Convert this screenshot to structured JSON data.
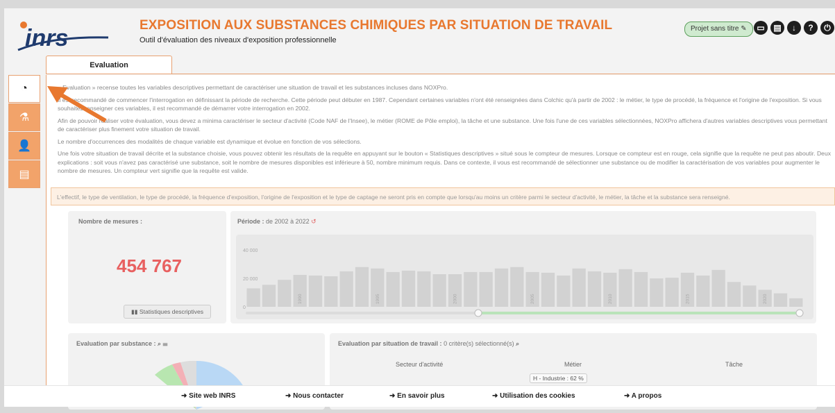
{
  "header": {
    "title": "EXPOSITION AUX SUBSTANCES CHIMIQUES PAR SITUATION DE TRAVAIL",
    "subtitle": "Outil d'évaluation des niveaux d'exposition professionnelle",
    "logo_text": "inrs",
    "project_button": "Projet sans titre"
  },
  "tabs": [
    {
      "label": "Evaluation"
    }
  ],
  "sidebar": [
    {
      "icon": "pie-chart-icon"
    },
    {
      "icon": "flask-icon"
    },
    {
      "icon": "user-settings-icon"
    },
    {
      "icon": "document-icon"
    }
  ],
  "intro": {
    "p1": "« Evaluation » recense toutes les variables descriptives permettant de caractériser une situation de travail et les substances incluses dans NOXPro.",
    "p2": "Il est recommandé de commencer l'interrogation en définissant la période de recherche. Cette période peut débuter en 1987. Cependant certaines variables n'ont été renseignées dans Colchic qu'à partir de 2002 : le métier, le type de procédé, la fréquence et l'origine de l'exposition. Si vous souhaitez renseigner ces variables, il est recommandé de démarrer votre interrogation en 2002.",
    "p3": "Afin de pouvoir réaliser votre évaluation, vous devez a minima caractériser le secteur d'activité (Code NAF de l'Insee), le métier (ROME de Pôle emploi), la tâche et une substance. Une fois l'une de ces variables sélectionnées, NOXPro affichera d'autres variables descriptives vous permettant de caractériser plus finement votre situation de travail.",
    "p4": "Le nombre d'occurrences des modalités de chaque variable est dynamique et évolue en fonction de vos sélections.",
    "p5": "Une fois votre situation de travail décrite et la substance choisie, vous pouvez obtenir les résultats de la requête en appuyant sur le bouton « Statistiques descriptives » situé sous le compteur de mesures. Lorsque ce compteur est en rouge, cela signifie que la requête ne peut pas aboutir. Deux explications : soit vous n'avez pas caractérisé une substance, soit le nombre de mesures disponibles est inférieure à 50, nombre minimum requis. Dans ce contexte, il vous est recommandé de sélectionner une substance ou de modifier la caractérisation de vos variables pour augmenter le nombre de mesures. Un compteur vert signifie que la requête est valide."
  },
  "notice": "L'effectif, le type de ventilation, le type de procédé, la fréquence d'exposition, l'origine de l'exposition et le type de captage ne seront pris en compte que lorsqu'au moins un critère parmi le secteur d'activité, le métier, la tâche et la substance sera renseigné.",
  "measures": {
    "label": "Nombre de mesures :",
    "count": "454 767",
    "stats_button": "Statistiques descriptives"
  },
  "period": {
    "label": "Période :",
    "from": "de 2002",
    "to": "à 2022"
  },
  "substance_card": {
    "label": "Evaluation par substance :"
  },
  "situation_card": {
    "label": "Evaluation par situation de travail :",
    "sub": "0 critère(s) sélectionné(s)",
    "cols": [
      "Secteur d'activité",
      "Métier",
      "Tâche"
    ],
    "tooltip": "H - Industrie : 62 %"
  },
  "chart_data": {
    "type": "bar",
    "categories": [
      "1987",
      "1988",
      "1989",
      "1990",
      "1991",
      "1992",
      "1993",
      "1994",
      "1995",
      "1996",
      "1997",
      "1998",
      "1999",
      "2000",
      "2001",
      "2002",
      "2003",
      "2004",
      "2005",
      "2006",
      "2007",
      "2008",
      "2009",
      "2010",
      "2011",
      "2012",
      "2013",
      "2014",
      "2015",
      "2016",
      "2017",
      "2018",
      "2019",
      "2020",
      "2021",
      "2022"
    ],
    "values": [
      13000,
      15500,
      19000,
      22500,
      22000,
      21500,
      25000,
      28000,
      27000,
      24500,
      25500,
      25000,
      23000,
      23000,
      24500,
      24500,
      27000,
      28000,
      24500,
      24000,
      22000,
      27000,
      25000,
      24000,
      26500,
      24500,
      20000,
      20500,
      24000,
      22000,
      26000,
      17500,
      15000,
      12000,
      9500,
      6000
    ],
    "ylim": [
      0,
      45000
    ],
    "yticks": [
      "40 000",
      "20 000",
      "0"
    ],
    "xticks": [
      "1990",
      "1995",
      "2000",
      "2005",
      "2010",
      "2015",
      "2020"
    ]
  },
  "footer": [
    {
      "label": "Site web INRS"
    },
    {
      "label": "Nous contacter"
    },
    {
      "label": "En savoir plus"
    },
    {
      "label": "Utilisation des cookies"
    },
    {
      "label": "A propos"
    }
  ]
}
